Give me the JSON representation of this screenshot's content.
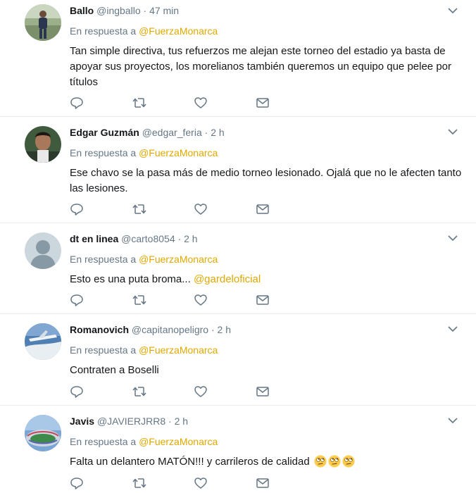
{
  "colors": {
    "accent": "#e0a800",
    "muted": "#657786",
    "text": "#14171a",
    "divider": "#e6ecf0"
  },
  "actions": {
    "icons": [
      "reply-icon",
      "retweet-icon",
      "like-icon",
      "direct-message-icon"
    ]
  },
  "tweets": [
    {
      "name": "Ballo",
      "handle": "@ingballo",
      "dot": "·",
      "time": "47 min",
      "reply_prefix": "En respuesta a",
      "reply_to": "@FuerzaMonarca",
      "text": "Tan simple directiva, tus refuerzos me alejan este torneo del estadio ya basta de apoyar sus proyectos, los morelianos también queremos un equipo que pelee por títulos",
      "avatar": "photo-person-standing"
    },
    {
      "name": "Edgar Guzmán",
      "handle": "@edgar_feria",
      "dot": "·",
      "time": "2 h",
      "reply_prefix": "En respuesta a",
      "reply_to": "@FuerzaMonarca",
      "text": "Ese chavo se la pasa más de medio torneo lesionado. Ojalá que no le afecten tanto las lesiones.",
      "avatar": "photo-person-selfie"
    },
    {
      "name": "dt en linea",
      "handle": "@carto8054",
      "dot": "·",
      "time": "2 h",
      "reply_prefix": "En respuesta a",
      "reply_to": "@FuerzaMonarca",
      "text": "Esto es una puta broma...",
      "text_mention": "@gardeloficial",
      "avatar": "default-avatar"
    },
    {
      "name": "Romanovich",
      "handle": "@capitanopeligro",
      "dot": "·",
      "time": "2 h",
      "reply_prefix": "En respuesta a",
      "reply_to": "@FuerzaMonarca",
      "text": "Contraten a Boselli",
      "avatar": "photo-airplane-sky"
    },
    {
      "name": "Javis",
      "handle": "@JAVIERJRR8",
      "dot": "·",
      "time": "2 h",
      "reply_prefix": "En respuesta a",
      "reply_to": "@FuerzaMonarca",
      "text": "Falta un delantero MATÓN!!! y carrileros de calidad",
      "emoji": "face-with-rolling-eyes-emoji",
      "avatar": "photo-stadium"
    }
  ]
}
